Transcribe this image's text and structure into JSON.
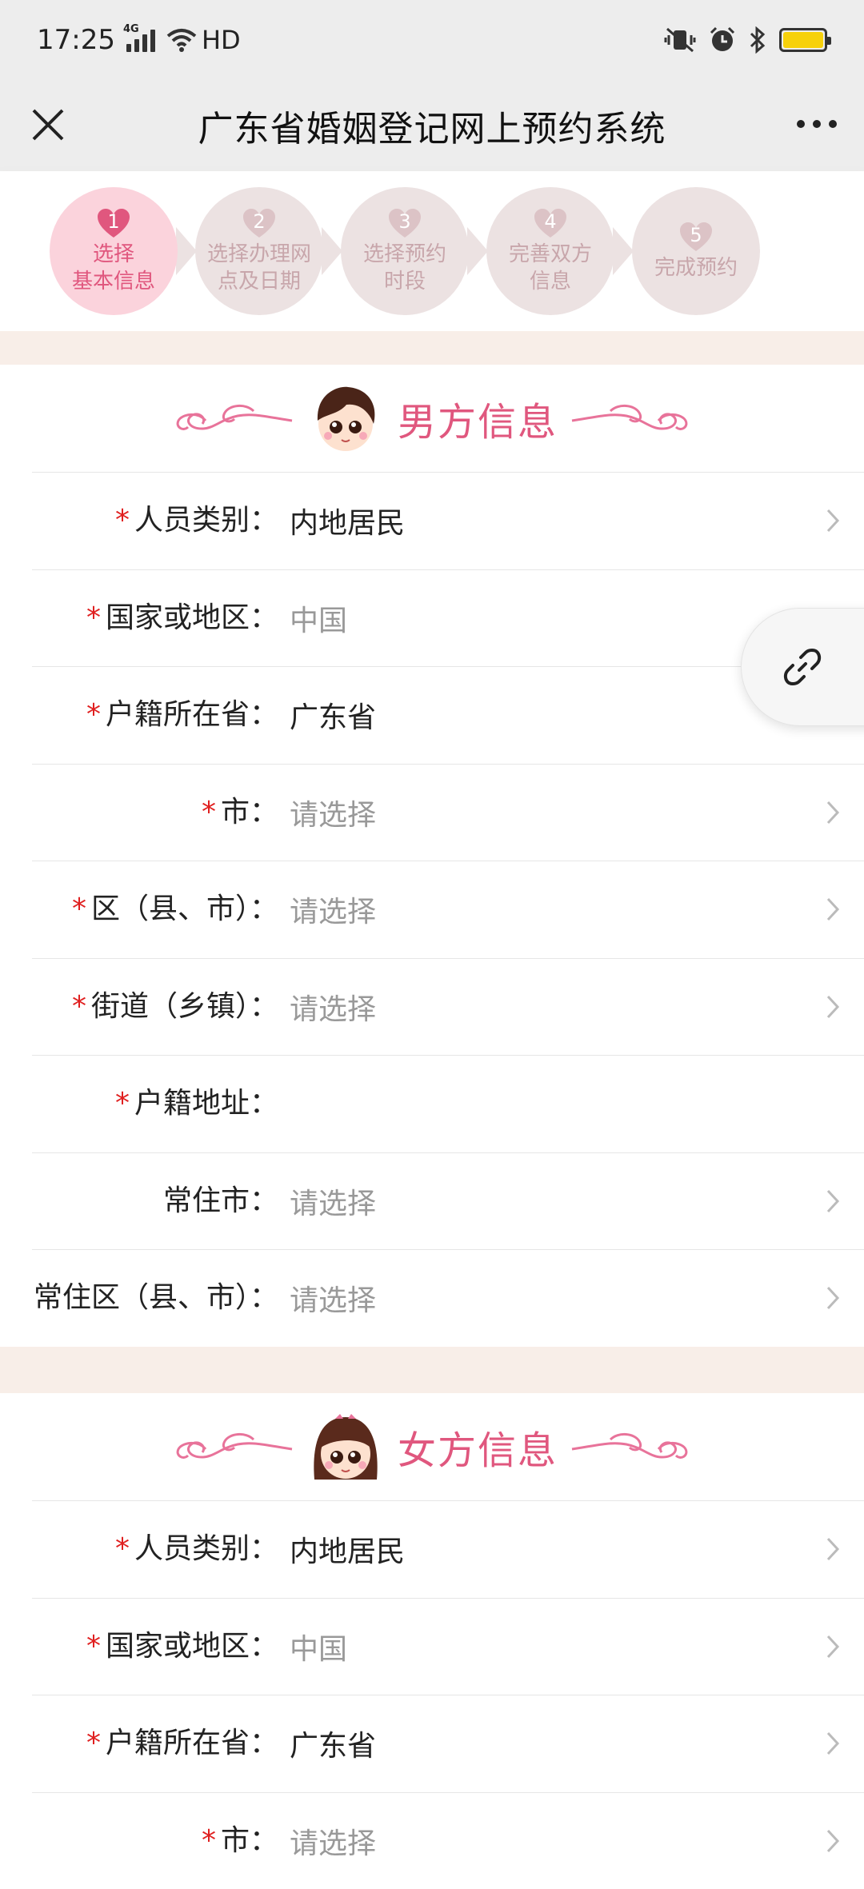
{
  "status": {
    "time": "17:25",
    "network": "4G",
    "hd": "HD"
  },
  "nav": {
    "title": "广东省婚姻登记网上预约系统"
  },
  "steps": [
    {
      "num": "1",
      "line1": "选择",
      "line2": "基本信息",
      "active": true
    },
    {
      "num": "2",
      "line1": "选择办理网",
      "line2": "点及日期",
      "active": false
    },
    {
      "num": "3",
      "line1": "选择预约",
      "line2": "时段",
      "active": false
    },
    {
      "num": "4",
      "line1": "完善双方",
      "line2": "信息",
      "active": false
    },
    {
      "num": "5",
      "line1": "完成预约",
      "line2": "",
      "active": false
    }
  ],
  "male": {
    "title": "男方信息",
    "rows": [
      {
        "required": true,
        "label": "人员类别：",
        "value": "内地居民",
        "placeholder": false
      },
      {
        "required": true,
        "label": "国家或地区：",
        "value": "中国",
        "placeholder": true
      },
      {
        "required": true,
        "label": "户籍所在省：",
        "value": "广东省",
        "placeholder": false
      },
      {
        "required": true,
        "label": "市：",
        "value": "请选择",
        "placeholder": true
      },
      {
        "required": true,
        "label": "区（县、市）：",
        "value": "请选择",
        "placeholder": true
      },
      {
        "required": true,
        "label": "街道（乡镇）：",
        "value": "请选择",
        "placeholder": true
      },
      {
        "required": true,
        "label": "户籍地址：",
        "value": "",
        "placeholder": false
      },
      {
        "required": false,
        "label": "常住市：",
        "value": "请选择",
        "placeholder": true
      },
      {
        "required": false,
        "label": "常住区（县、市）：",
        "value": "请选择",
        "placeholder": true
      }
    ]
  },
  "female": {
    "title": "女方信息",
    "rows": [
      {
        "required": true,
        "label": "人员类别：",
        "value": "内地居民",
        "placeholder": false
      },
      {
        "required": true,
        "label": "国家或地区：",
        "value": "中国",
        "placeholder": true
      },
      {
        "required": true,
        "label": "户籍所在省：",
        "value": "广东省",
        "placeholder": false
      },
      {
        "required": true,
        "label": "市：",
        "value": "请选择",
        "placeholder": true
      }
    ]
  },
  "colors": {
    "accent": "#e0577e",
    "required": "#e02020",
    "placeholder": "#999999"
  }
}
